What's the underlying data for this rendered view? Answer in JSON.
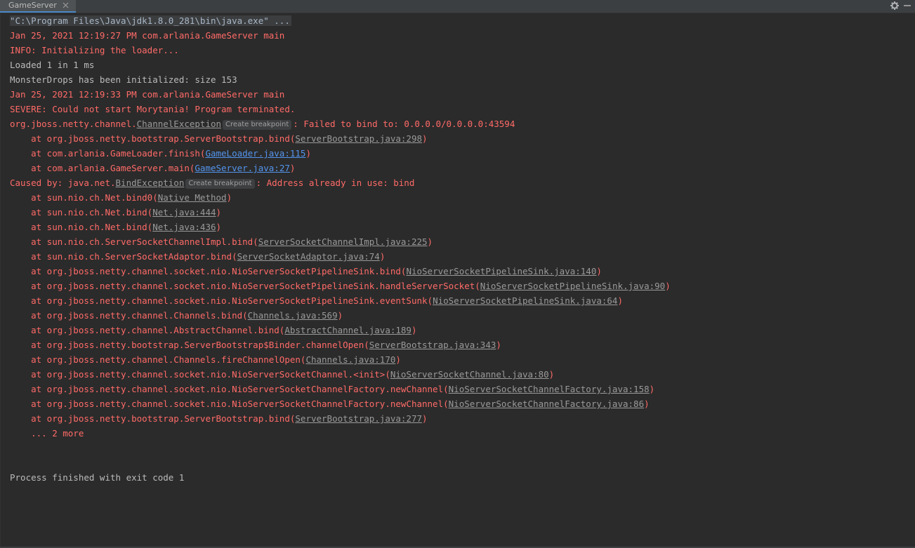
{
  "tab": {
    "title": "GameServer"
  },
  "toolbar": {
    "settings_icon": "gear-icon",
    "minimize_icon": "minimize-icon"
  },
  "breakpoint_label": "Create breakpoint",
  "console": {
    "command": "\"C:\\Program Files\\Java\\jdk1.8.0_281\\bin\\java.exe\" ...",
    "log1_time": "Jan 25, 2021 12:19:27 PM com.arlania.GameServer main",
    "log1_msg": "INFO: Initializing the loader...",
    "loaded": "Loaded 1 in 1 ms",
    "drops": "MonsterDrops has been initialized: size 153",
    "log2_time": "Jan 25, 2021 12:19:33 PM com.arlania.GameServer main",
    "log2_msg": "SEVERE: Could not start Morytania! Program terminated.",
    "exception": {
      "prefix": "org.jboss.netty.channel.",
      "class": "ChannelException",
      "message": ": Failed to bind to: 0.0.0.0/0.0.0.0:43594"
    },
    "trace1": [
      {
        "method": "    at org.jboss.netty.bootstrap.ServerBootstrap.bind(",
        "link": "ServerBootstrap.java:298",
        "style": "grey"
      },
      {
        "method": "    at com.arlania.GameLoader.finish(",
        "link": "GameLoader.java:115",
        "style": "blue"
      },
      {
        "method": "    at com.arlania.GameServer.main(",
        "link": "GameServer.java:27",
        "style": "blue"
      }
    ],
    "caused": {
      "prefix": "Caused by: java.net.",
      "class": "BindException",
      "message": ": Address already in use: bind"
    },
    "trace2": [
      {
        "method": "    at sun.nio.ch.Net.bind0(",
        "link": "Native Method"
      },
      {
        "method": "    at sun.nio.ch.Net.bind(",
        "link": "Net.java:444"
      },
      {
        "method": "    at sun.nio.ch.Net.bind(",
        "link": "Net.java:436"
      },
      {
        "method": "    at sun.nio.ch.ServerSocketChannelImpl.bind(",
        "link": "ServerSocketChannelImpl.java:225"
      },
      {
        "method": "    at sun.nio.ch.ServerSocketAdaptor.bind(",
        "link": "ServerSocketAdaptor.java:74"
      },
      {
        "method": "    at org.jboss.netty.channel.socket.nio.NioServerSocketPipelineSink.bind(",
        "link": "NioServerSocketPipelineSink.java:140"
      },
      {
        "method": "    at org.jboss.netty.channel.socket.nio.NioServerSocketPipelineSink.handleServerSocket(",
        "link": "NioServerSocketPipelineSink.java:90"
      },
      {
        "method": "    at org.jboss.netty.channel.socket.nio.NioServerSocketPipelineSink.eventSunk(",
        "link": "NioServerSocketPipelineSink.java:64"
      },
      {
        "method": "    at org.jboss.netty.channel.Channels.bind(",
        "link": "Channels.java:569"
      },
      {
        "method": "    at org.jboss.netty.channel.AbstractChannel.bind(",
        "link": "AbstractChannel.java:189"
      },
      {
        "method": "    at org.jboss.netty.bootstrap.ServerBootstrap$Binder.channelOpen(",
        "link": "ServerBootstrap.java:343"
      },
      {
        "method": "    at org.jboss.netty.channel.Channels.fireChannelOpen(",
        "link": "Channels.java:170"
      },
      {
        "method": "    at org.jboss.netty.channel.socket.nio.NioServerSocketChannel.<init>(",
        "link": "NioServerSocketChannel.java:80"
      },
      {
        "method": "    at org.jboss.netty.channel.socket.nio.NioServerSocketChannelFactory.newChannel(",
        "link": "NioServerSocketChannelFactory.java:158"
      },
      {
        "method": "    at org.jboss.netty.channel.socket.nio.NioServerSocketChannelFactory.newChannel(",
        "link": "NioServerSocketChannelFactory.java:86"
      },
      {
        "method": "    at org.jboss.netty.bootstrap.ServerBootstrap.bind(",
        "link": "ServerBootstrap.java:277"
      }
    ],
    "more": "    ... 2 more",
    "finished": "Process finished with exit code 1"
  },
  "colors": {
    "background": "#2b2b2b",
    "error": "#ff6b68",
    "normal": "#bbbbbb",
    "link_blue": "#5394ec",
    "link_grey": "#9a9a9a"
  }
}
